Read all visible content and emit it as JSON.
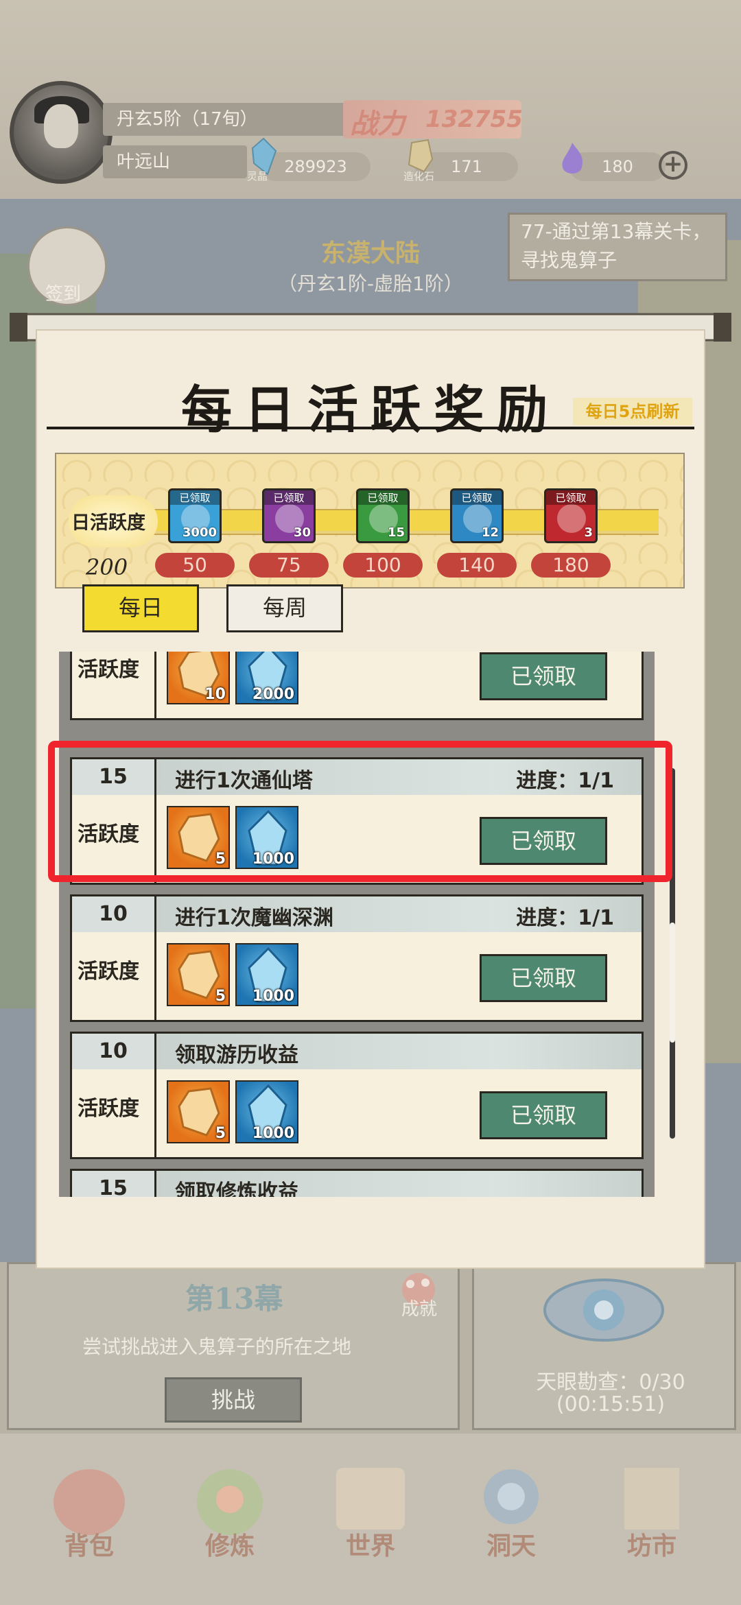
{
  "player": {
    "rank": "丹玄5阶（17旬）",
    "name": "叶远山",
    "power_label": "战力",
    "power_value": "132755"
  },
  "resources": [
    {
      "icon": "spirit-crystal-icon",
      "value": "289923",
      "label": "灵晶"
    },
    {
      "icon": "transform-stone-icon",
      "value": "171",
      "label": "造化石"
    },
    {
      "icon": "purple-flame-icon",
      "value": "180",
      "label": ""
    }
  ],
  "map": {
    "region_title": "东漠大陆",
    "region_sub": "（丹玄1阶-虚胎1阶）",
    "quest": "77-通过第13幕关卡，寻找鬼算子",
    "sign_in_label": "签到"
  },
  "stage": {
    "title": "第13幕",
    "description": "尝试挑战进入鬼算子的所在之地",
    "challenge_label": "挑战",
    "achievement_label": "成就",
    "eye_line1": "天眼勘查：0/30",
    "eye_line2": "(00:15:51)"
  },
  "nav": [
    "背包",
    "修炼",
    "世界",
    "洞天",
    "坊市"
  ],
  "modal": {
    "title": "每日活跃奖励",
    "refresh_note": "每日5点刷新",
    "activity_label": "日活跃度",
    "activity_value": "200",
    "activity_progress": 1.0,
    "claimed_label": "已领取",
    "chests": [
      {
        "qty": "3000",
        "threshold": "50",
        "color": "#3aa0d8",
        "icon": "crystal-reward-icon"
      },
      {
        "qty": "30",
        "threshold": "75",
        "color": "#8a3fa0",
        "icon": "jade-reward-icon"
      },
      {
        "qty": "15",
        "threshold": "100",
        "color": "#3a9a40",
        "icon": "mystery-reward-icon"
      },
      {
        "qty": "12",
        "threshold": "140",
        "color": "#2e88c4",
        "icon": "dragon-reward-icon"
      },
      {
        "qty": "3",
        "threshold": "180",
        "color": "#c0282f",
        "icon": "red-dragon-reward-icon"
      }
    ],
    "tabs": {
      "daily": "每日",
      "weekly": "每周"
    },
    "activity_word": "活跃度",
    "progress_prefix": "进度：",
    "tasks": [
      {
        "points": "",
        "name": "",
        "progress": "",
        "rewards": [
          "10",
          "2000"
        ],
        "button": "已领取"
      },
      {
        "points": "15",
        "name": "进行1次通仙塔",
        "progress": "1/1",
        "rewards": [
          "5",
          "1000"
        ],
        "button": "已领取"
      },
      {
        "points": "10",
        "name": "进行1次魔幽深渊",
        "progress": "1/1",
        "rewards": [
          "5",
          "1000"
        ],
        "button": "已领取"
      },
      {
        "points": "10",
        "name": "领取游历收益",
        "progress": "",
        "rewards": [
          "5",
          "1000"
        ],
        "button": "已领取"
      },
      {
        "points": "15",
        "name": "领取修炼收益",
        "progress": "",
        "rewards": [],
        "button": ""
      }
    ]
  }
}
